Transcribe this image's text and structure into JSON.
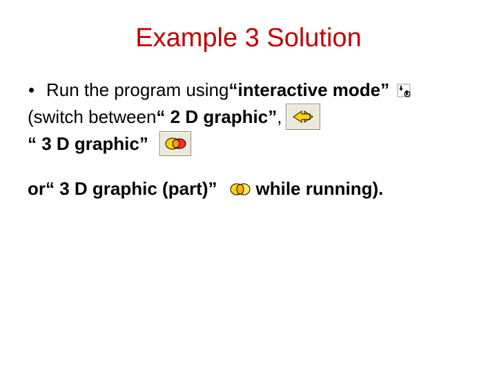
{
  "title": "Example 3 Solution",
  "bullet_prefix": "Run the program using ",
  "bullet_quote": "“interactive mode”",
  "line2a_prefix": "(switch between ",
  "line2a_quote": "“ 2 D graphic”",
  "line2a_suffix": " , ",
  "line2b_quote": " “ 3 D graphic”",
  "line3_prefix": "or ",
  "line3_quote": "“ 3 D graphic (part)”",
  "line3_suffix": "  while running).",
  "icons": {
    "interactive": "interactive-mode-icon",
    "g2d": "2d-graphic-icon",
    "g3d": "3d-graphic-icon",
    "g3dp": "3d-graphic-part-icon"
  }
}
